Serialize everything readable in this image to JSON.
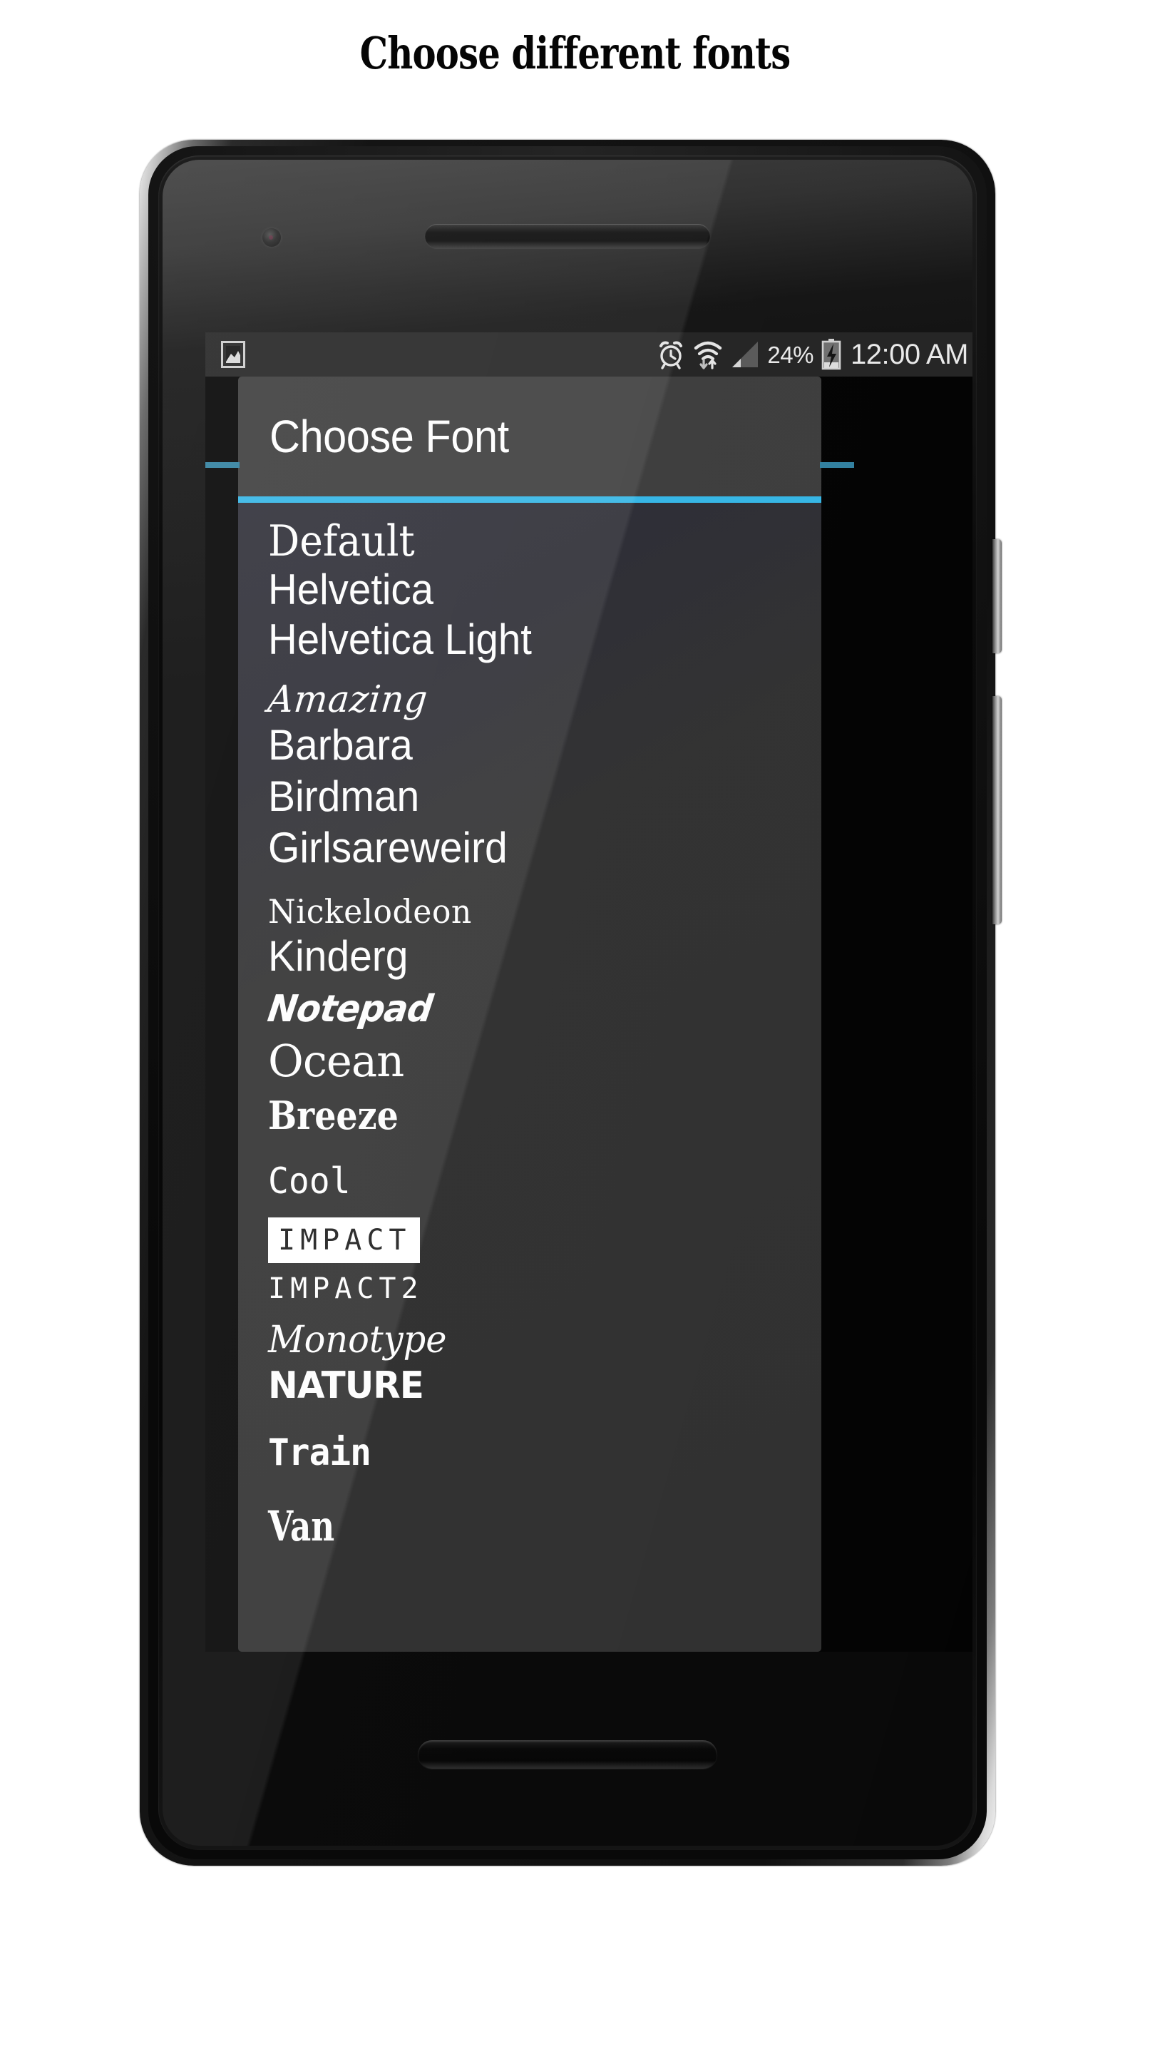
{
  "page": {
    "title": "Choose different fonts"
  },
  "device": {
    "name": "android-smartphone",
    "hardware": {
      "earpiece": "earpiece-speaker",
      "front_camera": "front-camera",
      "bottom_speaker": "bottom-speaker-slot",
      "power_button": "power-button",
      "volume_button": "volume-rocker-button"
    }
  },
  "status_bar": {
    "left_icons": [
      {
        "name": "image-icon",
        "glyph": "picture"
      }
    ],
    "right_icons": [
      {
        "name": "alarm-clock-icon",
        "glyph": "alarm"
      },
      {
        "name": "wifi-icon",
        "glyph": "wifi-with-transfer-arrows"
      },
      {
        "name": "cellular-signal-icon",
        "glyph": "signal-triangle"
      },
      {
        "name": "battery-charging-icon",
        "glyph": "battery-bolt"
      }
    ],
    "battery_percent": "24%",
    "clock": "12:00 AM"
  },
  "dialog": {
    "title": "Choose Font",
    "accent_color": "#33b5e5",
    "header_bg": "#3b3b3b",
    "body_bg": "#2e2e2e",
    "text_color": "#fdfdfd",
    "font_items": [
      {
        "label": "Default",
        "style": "f-default",
        "selected": false
      },
      {
        "label": "Helvetica",
        "style": "f-helvetica",
        "selected": false
      },
      {
        "label": "Helvetica Light",
        "style": "f-helv-light",
        "selected": false
      },
      {
        "label": "Amazing",
        "style": "f-amazing",
        "selected": false
      },
      {
        "label": "Barbara",
        "style": "f-barbara",
        "selected": false
      },
      {
        "label": "Birdman",
        "style": "f-birdman",
        "selected": false
      },
      {
        "label": "Girlsareweird",
        "style": "f-girls",
        "selected": false
      },
      {
        "label": "Nickelodeon",
        "style": "f-nickelodeon",
        "selected": false
      },
      {
        "label": "Kinderg",
        "style": "f-kinderg",
        "selected": false
      },
      {
        "label": "Notepad",
        "style": "f-notepad",
        "selected": false
      },
      {
        "label": "Ocean",
        "style": "f-ocean",
        "selected": false
      },
      {
        "label": "Breeze",
        "style": "f-breeze",
        "selected": false
      },
      {
        "label": "Cool",
        "style": "f-cool",
        "selected": false
      },
      {
        "label": "IMPACT",
        "style": "f-impact",
        "selected": true
      },
      {
        "label": "IMPACT2",
        "style": "f-impact2",
        "selected": false
      },
      {
        "label": "Monotype",
        "style": "f-monotype",
        "selected": false
      },
      {
        "label": "NATURE",
        "style": "f-nature",
        "selected": false
      },
      {
        "label": "Train",
        "style": "f-train",
        "selected": false
      },
      {
        "label": "Van",
        "style": "f-van",
        "selected": false
      }
    ]
  }
}
